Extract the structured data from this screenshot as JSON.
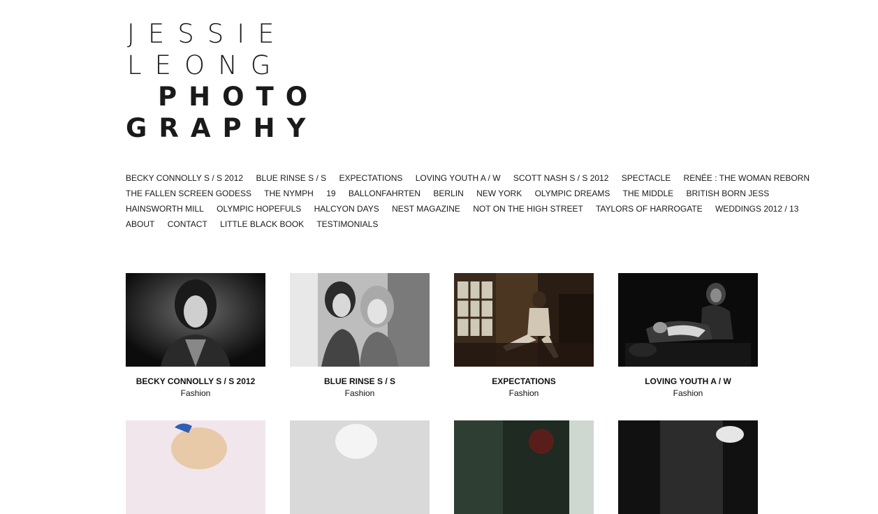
{
  "logo": {
    "line1": "JESSIE",
    "line2": "LEONG",
    "line3": "PHOTO",
    "line4": "GRAPHY"
  },
  "nav": {
    "rows": [
      [
        "BECKY CONNOLLY S / S 2012",
        "BLUE RINSE S / S",
        "EXPECTATIONS",
        "LOVING YOUTH A / W",
        "SCOTT NASH S / S 2012",
        "SPECTACLE",
        "RENÉE : THE WOMAN REBORN"
      ],
      [
        "THE FALLEN SCREEN GODESS",
        "THE NYMPH",
        "19",
        "BALLONFAHRTEN",
        "BERLIN",
        "NEW YORK",
        "OLYMPIC DREAMS",
        "THE MIDDLE",
        "BRITISH BORN JESS"
      ],
      [
        "HAINSWORTH MILL",
        "OLYMPIC HOPEFULS",
        "HALCYON DAYS",
        "NEST MAGAZINE",
        "NOT ON THE HIGH STREET",
        "TAYLORS OF HARROGATE",
        "WEDDINGS 2012 / 13"
      ],
      [
        "ABOUT",
        "CONTACT",
        "LITTLE BLACK BOOK",
        "TESTIMONIALS"
      ]
    ]
  },
  "projects": [
    {
      "title": "BECKY CONNOLLY S / S 2012",
      "category": "Fashion"
    },
    {
      "title": "BLUE RINSE S / S",
      "category": "Fashion"
    },
    {
      "title": "EXPECTATIONS",
      "category": "Fashion"
    },
    {
      "title": "LOVING YOUTH A / W",
      "category": "Fashion"
    }
  ]
}
